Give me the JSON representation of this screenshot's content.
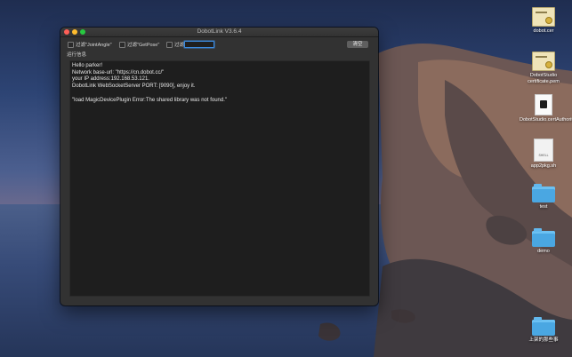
{
  "window": {
    "title": "DobotLink V3.6.4"
  },
  "toolbar": {
    "filter_joint": "过滤\"JointAngle\"",
    "filter_getpose": "过滤\"GetPose\"",
    "filter_label": "过滤",
    "filter_value": "",
    "clear_label": "清空"
  },
  "log": {
    "section_label": "运行信息",
    "lines": [
      "Hello parker!",
      "Network base-url: \"https://cn.dobot.cc/\"",
      "your IP address:192.168.53.121.",
      "DobotLink WebSocketServer PORT: [9090], enjoy it.",
      "",
      "\"load MagicDevicePlugin Error:The shared library was not found.\""
    ]
  },
  "desktop": {
    "icons": [
      {
        "label": "dobot.cer",
        "type": "certificate"
      },
      {
        "label": "DobotStudio certificate.pem",
        "type": "certificate"
      },
      {
        "label": "DobotStudio.certAuthorityConfig",
        "type": "document"
      },
      {
        "label": "app2pkg.sh",
        "type": "shell"
      },
      {
        "label": "test",
        "type": "folder"
      },
      {
        "label": "demo",
        "type": "folder"
      },
      {
        "label": "上架的那些事",
        "type": "folder"
      }
    ]
  },
  "colors": {
    "window_bg": "#323232",
    "log_bg": "#1e1e1e",
    "accent": "#3b8be0",
    "folder": "#4aa7e2"
  }
}
